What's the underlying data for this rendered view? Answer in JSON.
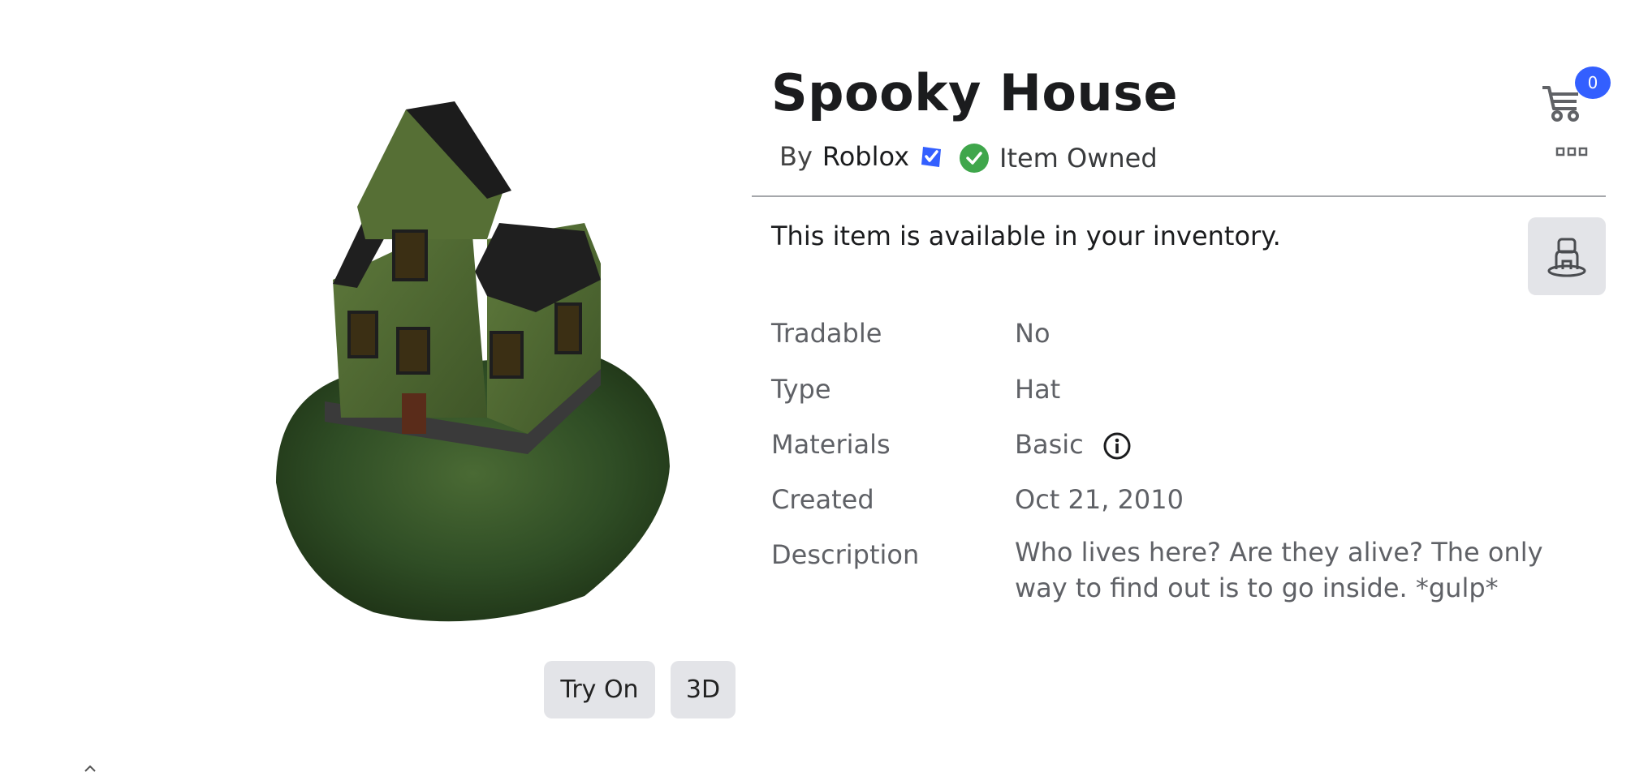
{
  "item": {
    "title": "Spooky House",
    "by_prefix": "By",
    "creator": "Roblox",
    "owned_label": "Item Owned",
    "availability": "This item is available in your inventory."
  },
  "cart": {
    "count": "0"
  },
  "buttons": {
    "try_on": "Try On",
    "view_3d": "3D"
  },
  "details": {
    "tradable_label": "Tradable",
    "tradable_value": "No",
    "type_label": "Type",
    "type_value": "Hat",
    "materials_label": "Materials",
    "materials_value": "Basic",
    "created_label": "Created",
    "created_value": "Oct 21, 2010",
    "description_label": "Description",
    "description_value": "Who lives here? Are they alive? The only way to find out is to go inside. *gulp*"
  },
  "colors": {
    "verified": "#335fff",
    "owned_check": "#3fa64b",
    "cart_badge": "#335fff"
  },
  "icons": [
    "verified-badge-icon",
    "check-circle-icon",
    "cart-icon",
    "more-dots-icon",
    "avatar-icon",
    "info-icon"
  ]
}
